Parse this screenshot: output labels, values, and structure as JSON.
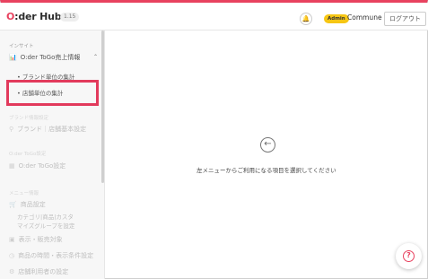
{
  "header": {
    "logo_prefix": "O",
    "logo_rest": ":der Hub",
    "version": "1.15",
    "role_badge": "Admin",
    "org_name": "Commune",
    "logout_label": "ログアウト",
    "bell_icon": "bell-icon"
  },
  "sidebar": {
    "sec_insight": "インサイト",
    "item_sales": "O:der ToGo売上情報",
    "sub_brand": "ブランド単位の集計",
    "sub_store": "店舗単位の集計",
    "sec_brand": "ブランド情報設定",
    "item_brand": "ブランド｜店舗基本設定",
    "sec_togo": "O:der ToGo設定",
    "item_togo": "O:der ToGo設定",
    "sec_menu": "メニュー情報",
    "item_product": "商品設定",
    "sub_cat1": "カテゴリ|商品|カスタ",
    "sub_cat2": "マイズグループを設定",
    "item_stock": "表示・販売対象",
    "item_product2": "商品の時間・表示条件設定",
    "item_more": "店舗利用者の設定"
  },
  "main": {
    "empty_message": "左メニューからご利用になる項目を選択してください"
  },
  "colors": {
    "accent": "#e8425f",
    "badge": "#f6c614",
    "highlight": "#e23a5c"
  }
}
